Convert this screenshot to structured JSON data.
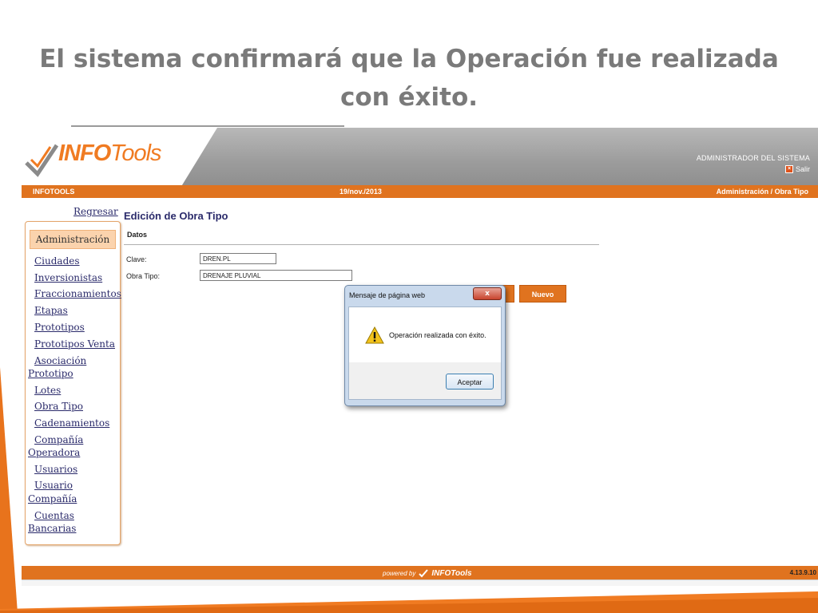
{
  "slide": {
    "title_line1": "El sistema confirmará que la Operación fue realizada",
    "title_line2": "con éxito."
  },
  "header": {
    "logo_info": "INFO",
    "logo_tools": "Tools",
    "admin_label": "ADMINISTRADOR DEL SISTEMA",
    "salir_label": "Salir"
  },
  "infobar": {
    "left": "INFOTOOLS",
    "date": "19/nov./2013",
    "breadcrumb": "Administración / Obra Tipo"
  },
  "sidebar": {
    "back_link": "Regresar",
    "heading": "Administración",
    "items": [
      {
        "label": "Ciudades"
      },
      {
        "label": "Inversionistas"
      },
      {
        "label": "Fraccionamientos"
      },
      {
        "label": "Etapas"
      },
      {
        "label": "Prototipos"
      },
      {
        "label": "Prototipos Venta"
      },
      {
        "label": "Asociación",
        "label2": "Prototipo"
      },
      {
        "label": "Lotes"
      },
      {
        "label": "Obra Tipo"
      },
      {
        "label": "Cadenamientos"
      },
      {
        "label": "Compañía",
        "label2": "Operadora"
      },
      {
        "label": "Usuarios"
      },
      {
        "label": "Usuario",
        "label2": "Compañía"
      },
      {
        "label": "Cuentas",
        "label2": "Bancarias"
      }
    ]
  },
  "form": {
    "title": "Edición de Obra Tipo",
    "section": "Datos",
    "clave_label": "Clave:",
    "clave_value": "DREN.PL",
    "obra_tipo_label": "Obra Tipo:",
    "obra_tipo_value": "DRENAJE PLUVIAL",
    "nuevo_button": "Nuevo"
  },
  "dialog": {
    "title": "Mensaje de página web",
    "message": "Operación realizada con éxito.",
    "ok_button": "Aceptar",
    "close_glyph": "x"
  },
  "footer": {
    "powered_by": "powered by",
    "brand_info": "INFO",
    "brand_tools": "Tools",
    "version": "4.13.9.10"
  },
  "colors": {
    "accent": "#e0731f",
    "title_gray": "#7a7a7a",
    "link": "#2b2b6b"
  }
}
